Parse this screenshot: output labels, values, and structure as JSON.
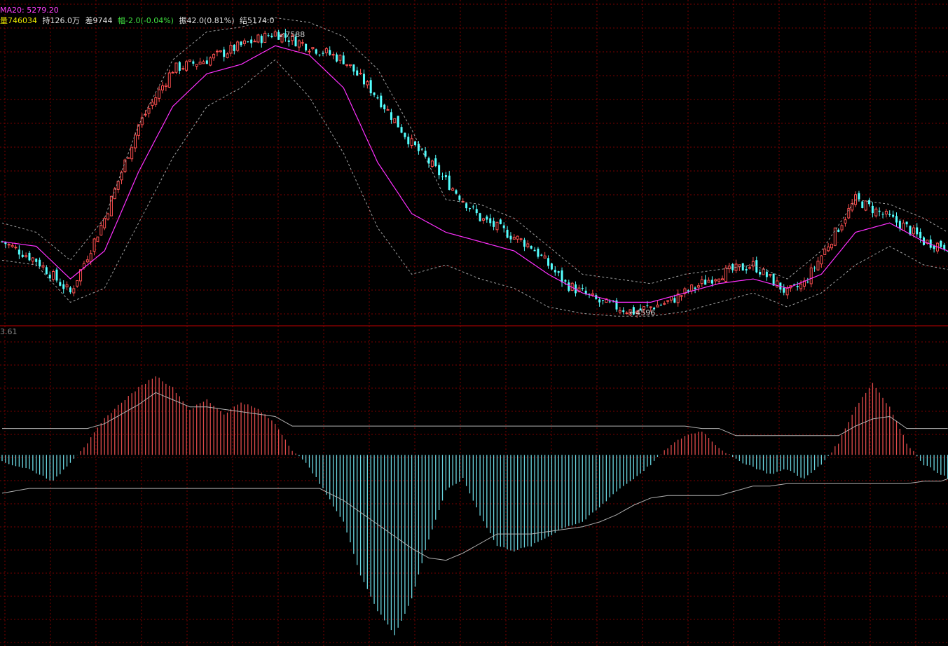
{
  "header": {
    "ma20_label": "MA20:",
    "ma20_value": "5279.20",
    "vol_label": "量",
    "vol_value": "746034",
    "hold_label": "持",
    "hold_value": "126.0万",
    "diff_label": "差",
    "diff_value": "9744",
    "chg_label": "幅",
    "chg_value": "-2.0(-0.04%)",
    "amp_label": "振",
    "amp_value": "42.0(0.81%)",
    "settle_label": "结",
    "settle_value": "5174.0"
  },
  "lower_panel": {
    "top_value_label": "3.61"
  },
  "annotations": {
    "high_label": "7588",
    "low_label": "4596"
  },
  "colors": {
    "up": "#ff5050",
    "down": "#54ffff",
    "ma": "#ff30ff",
    "band": "#a0a0a0",
    "grid": "#7a0000",
    "separator": "#c00000",
    "hist_up": "#e04a4a",
    "hist_down": "#6ad6e0",
    "signal": "#b0b0b0",
    "ma_text": "#ff40ff",
    "vol_text": "#e8e800",
    "chg_text": "#40e040",
    "neutral_text": "#e0e0e0"
  },
  "chart_data": {
    "type": "candlestick",
    "title": "",
    "upper": {
      "series_name": "MA20",
      "close_x": [
        0,
        10,
        20,
        30,
        40,
        50,
        60,
        70,
        80,
        100,
        110,
        120,
        140,
        150,
        155,
        165,
        175,
        185,
        195,
        200,
        210,
        220,
        230,
        235,
        245,
        250,
        265,
        270,
        277
      ],
      "close_y": [
        5350,
        5150,
        4800,
        5600,
        6600,
        7200,
        7300,
        7450,
        7588,
        7300,
        6900,
        6400,
        5600,
        5400,
        5300,
        4900,
        4700,
        4596,
        4700,
        4800,
        5000,
        5100,
        4800,
        4900,
        5500,
        5800,
        5500,
        5350,
        5300
      ],
      "ma_x": [
        0,
        10,
        20,
        30,
        40,
        50,
        60,
        70,
        80,
        90,
        100,
        110,
        120,
        130,
        140,
        150,
        160,
        170,
        180,
        190,
        200,
        210,
        220,
        230,
        240,
        250,
        260,
        270,
        277
      ],
      "ma_y": [
        5350,
        5300,
        4950,
        5250,
        6100,
        6800,
        7150,
        7250,
        7450,
        7350,
        7000,
        6200,
        5650,
        5450,
        5350,
        5250,
        5000,
        4800,
        4700,
        4700,
        4800,
        4900,
        4950,
        4850,
        5000,
        5450,
        5550,
        5350,
        5250
      ],
      "band_upper_y": [
        5550,
        5450,
        5150,
        5600,
        6600,
        7300,
        7600,
        7650,
        7750,
        7700,
        7550,
        7200,
        6550,
        5800,
        5750,
        5600,
        5300,
        5000,
        4950,
        4900,
        5000,
        5050,
        5100,
        4950,
        5250,
        5800,
        5750,
        5600,
        5450
      ],
      "band_lower_y": [
        5150,
        5100,
        4700,
        4850,
        5550,
        6250,
        6800,
        7000,
        7300,
        6900,
        6300,
        5500,
        5000,
        5100,
        4950,
        4850,
        4650,
        4580,
        4550,
        4550,
        4600,
        4700,
        4800,
        4650,
        4800,
        5100,
        5300,
        5100,
        5050
      ],
      "ylim": [
        4560,
        7640
      ],
      "high_label": "7588",
      "low_label": "4596"
    },
    "lower": {
      "x": [
        0,
        8,
        15,
        20,
        25,
        30,
        35,
        40,
        45,
        50,
        55,
        60,
        65,
        70,
        75,
        80,
        85,
        90,
        93,
        100,
        105,
        110,
        115,
        120,
        125,
        130,
        135,
        140,
        145,
        150,
        155,
        160,
        165,
        170,
        175,
        180,
        185,
        190,
        195,
        200,
        205,
        210,
        215,
        220,
        225,
        230,
        235,
        240,
        245,
        250,
        255,
        260,
        265,
        270,
        275,
        277
      ],
      "hist": [
        -0.3,
        -0.6,
        -1.1,
        -0.3,
        0.5,
        1.5,
        2.2,
        2.8,
        3.3,
        2.8,
        1.9,
        2.3,
        1.7,
        2.2,
        1.9,
        1.3,
        0.2,
        -0.5,
        -1.2,
        -2.8,
        -5.0,
        -6.5,
        -7.5,
        -6.0,
        -3.5,
        -1.5,
        -1.0,
        -2.5,
        -3.8,
        -4.0,
        -3.8,
        -3.4,
        -3.0,
        -2.8,
        -2.2,
        -1.5,
        -1.0,
        -0.4,
        0.3,
        0.8,
        1.0,
        0.3,
        -0.2,
        -0.5,
        -0.8,
        -0.6,
        -1.0,
        -0.4,
        0.5,
        2.0,
        3.0,
        2.0,
        0.5,
        -0.4,
        -0.8,
        -1.0
      ],
      "signal": [
        1.1,
        1.1,
        1.1,
        1.1,
        1.1,
        1.3,
        1.7,
        2.1,
        2.6,
        2.3,
        2.0,
        2.0,
        1.9,
        1.8,
        1.7,
        1.6,
        1.2,
        1.2,
        1.2,
        1.2,
        1.2,
        1.2,
        1.2,
        1.2,
        1.2,
        1.2,
        1.2,
        1.2,
        1.2,
        1.2,
        1.2,
        1.2,
        1.2,
        1.2,
        1.2,
        1.2,
        1.2,
        1.2,
        1.2,
        1.2,
        1.1,
        1.1,
        0.8,
        0.8,
        0.8,
        0.8,
        0.8,
        0.8,
        0.8,
        1.2,
        1.5,
        1.6,
        1.1,
        1.1,
        1.1,
        1.1
      ],
      "lower_line": [
        -1.6,
        -1.4,
        -1.4,
        -1.4,
        -1.4,
        -1.4,
        -1.4,
        -1.4,
        -1.4,
        -1.4,
        -1.4,
        -1.4,
        -1.4,
        -1.4,
        -1.4,
        -1.4,
        -1.4,
        -1.4,
        -1.4,
        -1.9,
        -2.4,
        -2.9,
        -3.4,
        -3.9,
        -4.3,
        -4.4,
        -4.1,
        -3.7,
        -3.3,
        -3.3,
        -3.3,
        -3.2,
        -3.1,
        -3.0,
        -2.8,
        -2.5,
        -2.1,
        -1.8,
        -1.7,
        -1.7,
        -1.7,
        -1.7,
        -1.5,
        -1.3,
        -1.3,
        -1.2,
        -1.2,
        -1.2,
        -1.2,
        -1.2,
        -1.2,
        -1.2,
        -1.2,
        -1.1,
        -1.1,
        -1.0
      ],
      "ylim": [
        -7.8,
        4.8
      ],
      "top_label": "3.61"
    },
    "bars": 278,
    "grid": true
  }
}
